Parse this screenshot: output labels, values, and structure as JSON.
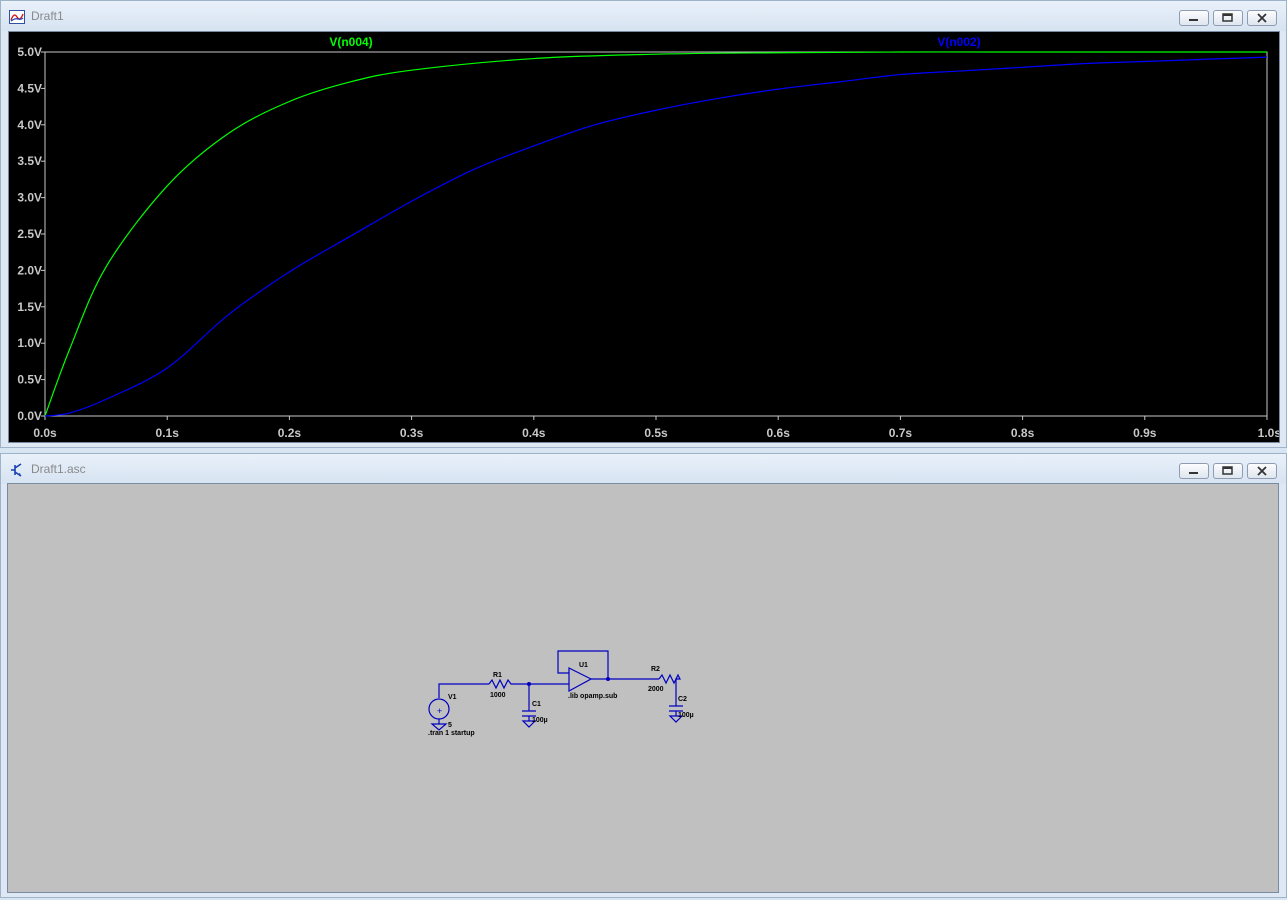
{
  "plot_window": {
    "title": "Draft1",
    "icon": "waveform-icon",
    "controls": [
      "minimize-icon",
      "restore-icon",
      "close-icon"
    ]
  },
  "schematic_window": {
    "title": "Draft1.asc",
    "icon": "schematic-transistor-icon",
    "controls": [
      "minimize-icon",
      "restore-icon",
      "close-icon"
    ]
  },
  "chart_data": {
    "type": "line",
    "x_ticks": [
      "0.0s",
      "0.1s",
      "0.2s",
      "0.3s",
      "0.4s",
      "0.5s",
      "0.6s",
      "0.7s",
      "0.8s",
      "0.9s",
      "1.0s"
    ],
    "y_ticks": [
      "0.0V",
      "0.5V",
      "1.0V",
      "1.5V",
      "2.0V",
      "2.5V",
      "3.0V",
      "3.5V",
      "4.0V",
      "4.5V",
      "5.0V"
    ],
    "xlim": [
      0,
      1.0
    ],
    "ylim": [
      0,
      5.0
    ],
    "grid": false,
    "background": "#000000",
    "axis_color": "#c8c8c8",
    "series": [
      {
        "name": "V(n004)",
        "color": "#00ff00",
        "x": [
          0,
          0.02,
          0.05,
          0.1,
          0.15,
          0.2,
          0.25,
          0.3,
          0.4,
          0.5,
          0.6,
          0.7,
          0.8,
          0.9,
          1.0
        ],
        "y": [
          0,
          0.91,
          2.05,
          3.16,
          3.88,
          4.32,
          4.59,
          4.75,
          4.91,
          4.97,
          4.99,
          5.0,
          5.0,
          5.0,
          5.0
        ]
      },
      {
        "name": "V(n002)",
        "color": "#0000ff",
        "x": [
          0,
          0.02,
          0.05,
          0.1,
          0.15,
          0.2,
          0.25,
          0.3,
          0.35,
          0.4,
          0.45,
          0.5,
          0.55,
          0.6,
          0.65,
          0.7,
          0.75,
          0.8,
          0.85,
          0.9,
          0.95,
          1.0
        ],
        "y": [
          0,
          0.04,
          0.23,
          0.66,
          1.39,
          1.98,
          2.47,
          2.95,
          3.38,
          3.71,
          4.0,
          4.2,
          4.36,
          4.49,
          4.59,
          4.69,
          4.74,
          4.79,
          4.84,
          4.87,
          4.9,
          4.93
        ]
      }
    ]
  },
  "schematic": {
    "wire_color": "#0000c0",
    "labels": {
      "v1_name": "V1",
      "v1_value": "5",
      "r1_name": "R1",
      "r1_value": "1000",
      "c1_name": "C1",
      "c1_value": "100µ",
      "u1_name": "U1",
      "u1_model": ".lib opamp.sub",
      "r2_name": "R2",
      "r2_value": "2000",
      "c2_name": "C2",
      "c2_value": "100µ",
      "tran_directive": ".tran 1 startup"
    }
  }
}
